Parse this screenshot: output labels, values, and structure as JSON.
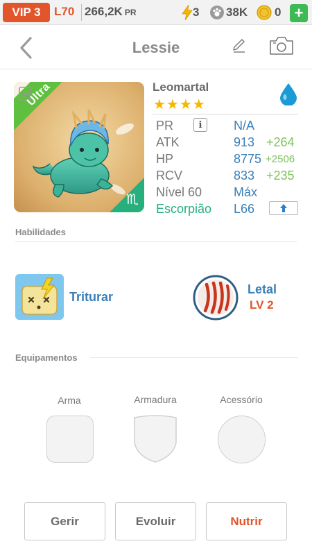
{
  "topbar": {
    "vip": "VIP 3",
    "level": "L70",
    "power": "266,2K",
    "power_unit": "PR",
    "energy": "3",
    "paws": "38K",
    "coins": "0",
    "plus": "+"
  },
  "header": {
    "title": "Lessie"
  },
  "pet": {
    "species": "Leomartal",
    "stars": "★★★★",
    "ribbon": "Ultra",
    "zodiac_symbol": "♏",
    "stats": [
      {
        "label": "PR",
        "value": "N/A",
        "bonus": ""
      },
      {
        "label": "ATK",
        "value": "913",
        "bonus": "+264"
      },
      {
        "label": "HP",
        "value": "8775",
        "bonus": "+2506"
      },
      {
        "label": "RCV",
        "value": "833",
        "bonus": "+235"
      },
      {
        "label": "Nível 60",
        "value": "Máx",
        "bonus": ""
      },
      {
        "label": "Escorpião",
        "value": "L66",
        "bonus": ""
      }
    ],
    "info_icon": "i"
  },
  "skills": {
    "section_label": "Habilidades",
    "active": {
      "name": "Triturar"
    },
    "passive": {
      "name": "Letal",
      "level": "LV 2"
    }
  },
  "equipment": {
    "section_label": "Equipamentos",
    "slots": [
      "Arma",
      "Armadura",
      "Acessório"
    ]
  },
  "actions": {
    "manage": "Gerir",
    "evolve": "Evoluir",
    "feed": "Nutrir"
  },
  "colors": {
    "accent_orange": "#e2542a",
    "value_blue": "#3a7fb8",
    "bonus_green": "#7dc35a",
    "zodiac_green": "#27b07d",
    "star_gold": "#f5b800"
  }
}
